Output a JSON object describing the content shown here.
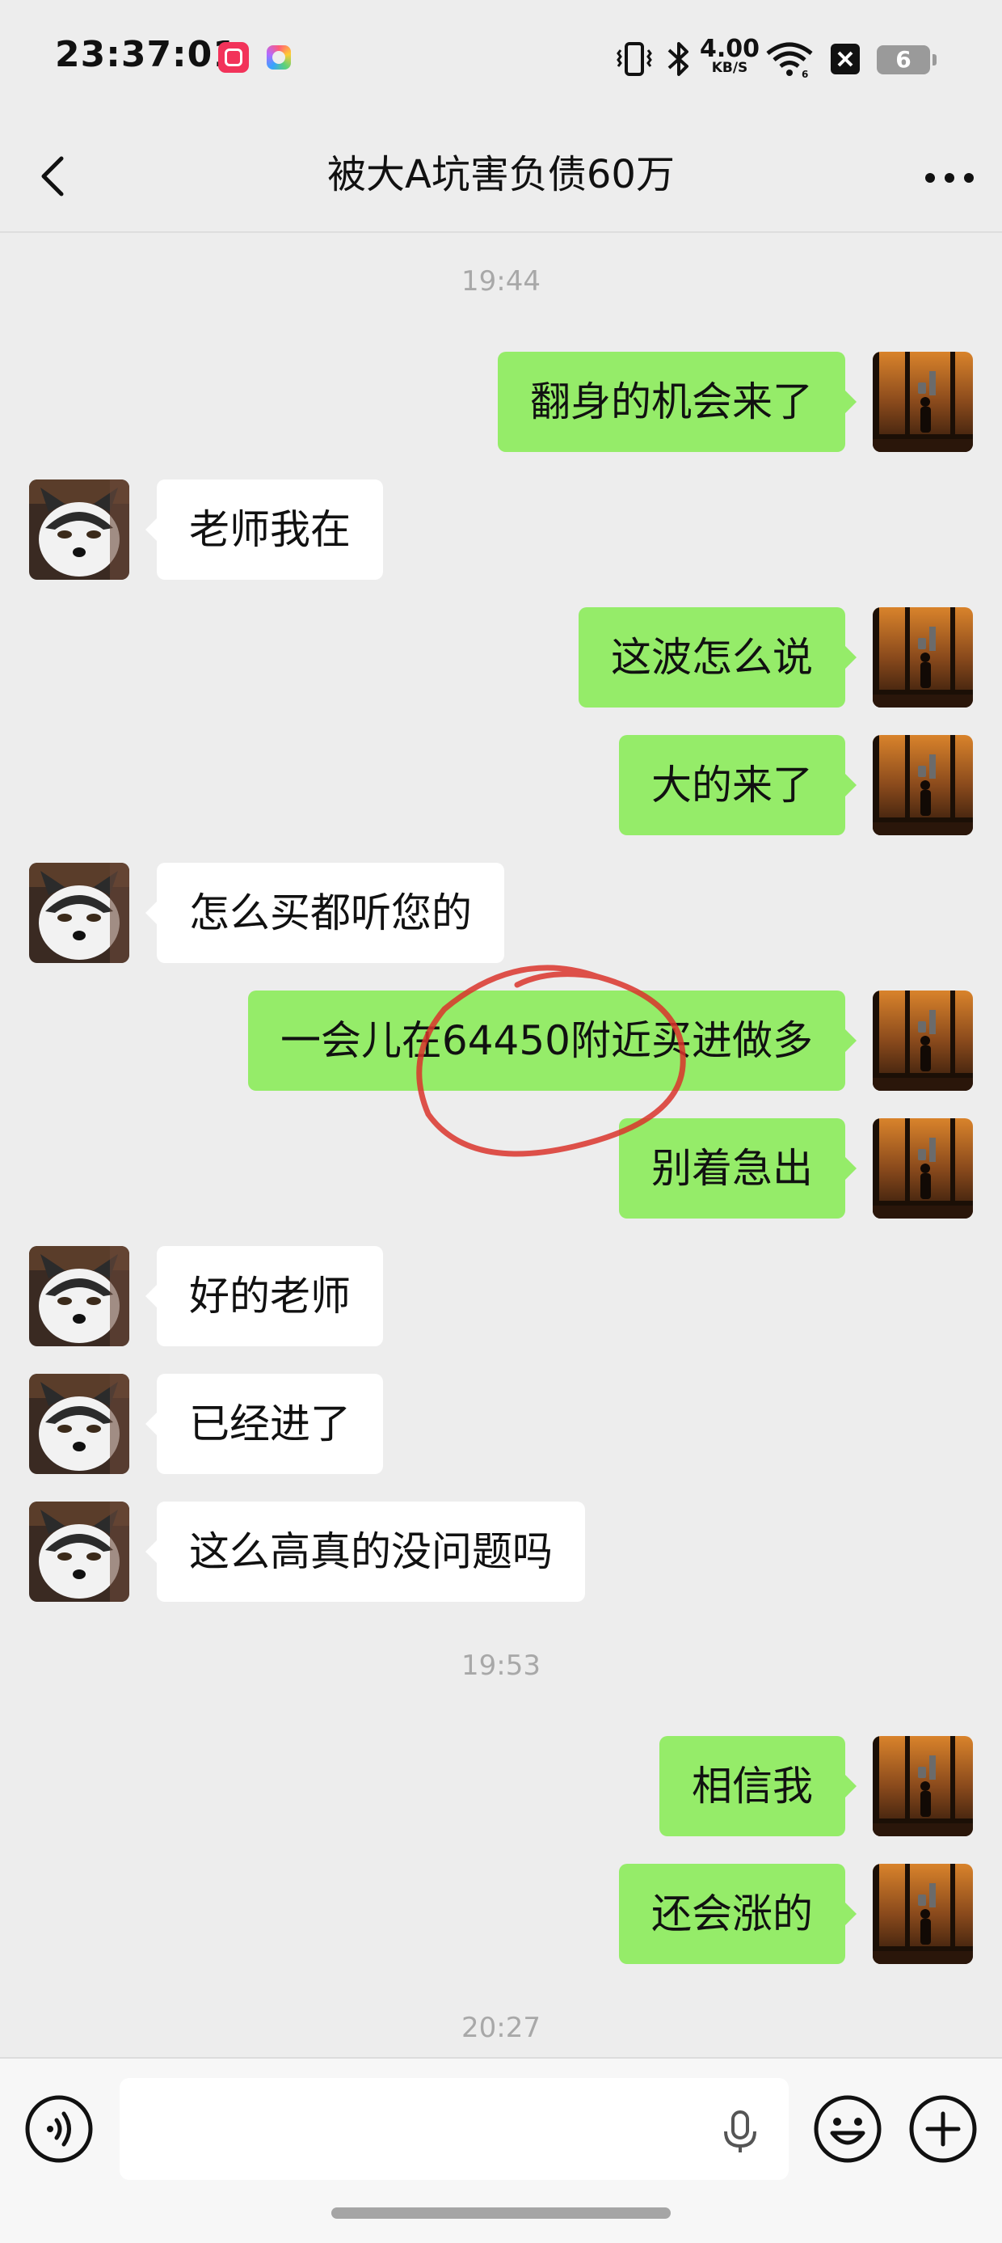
{
  "status_bar": {
    "time": "23:37:01",
    "net_speed_value": "4.00",
    "net_speed_unit": "KB/S",
    "battery_level": "6",
    "icons": [
      "app-red-icon",
      "app-color-icon",
      "vibrate-icon",
      "bluetooth-icon",
      "wifi-icon",
      "close-box-icon",
      "battery-icon"
    ]
  },
  "header": {
    "title": "被大A坑害负债60万",
    "back_icon": "chevron-left-icon",
    "more_icon": "more-dots-icon"
  },
  "messages": {
    "ts1": "19:44",
    "m1": "翻身的机会来了",
    "m2": "老师我在",
    "m3": "这波怎么说",
    "m4": "大的来了",
    "m5": "怎么买都听您的",
    "m6": "一会儿在64450附近买进做多",
    "m7": "别着急出",
    "m8": "好的老师",
    "m9": "已经进了",
    "m10": "这么高真的没问题吗",
    "ts2": "19:53",
    "m11": "相信我",
    "m12": "还会涨的",
    "ts3": "20:27"
  },
  "input_bar": {
    "value": "",
    "placeholder": "",
    "icons": [
      "voice-icon",
      "microphone-icon",
      "emoji-icon",
      "plus-icon"
    ]
  },
  "colors": {
    "sent_bubble": "#95ec69",
    "received_bubble": "#ffffff",
    "background": "#ededed",
    "annotation_circle": "#d9342b"
  }
}
